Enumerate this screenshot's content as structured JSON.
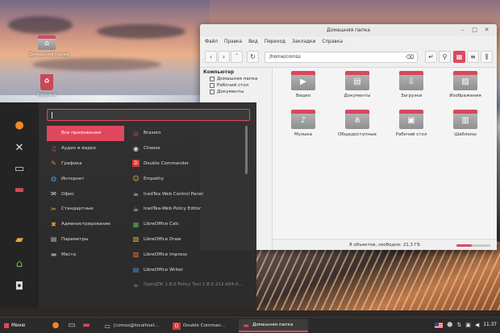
{
  "desktop": {
    "icons": [
      {
        "label": "Домашняя папка",
        "icon": "home-folder-icon"
      },
      {
        "label": "Корзина",
        "icon": "trash-icon"
      }
    ]
  },
  "file_manager": {
    "title": "Домашняя папка",
    "menu": [
      "Файл",
      "Правка",
      "Вид",
      "Переход",
      "Закладки",
      "Справка"
    ],
    "path": "/home/comss",
    "sidebar": {
      "heading": "Компьютер",
      "items": [
        "Домашняя папка",
        "Рабочий стол",
        "Документы"
      ]
    },
    "folders": [
      {
        "name": "Видео",
        "icon": "video-folder-icon",
        "glyph": "▶"
      },
      {
        "name": "Документы",
        "icon": "documents-folder-icon",
        "glyph": "▤"
      },
      {
        "name": "Загрузки",
        "icon": "downloads-folder-icon",
        "glyph": "⇩"
      },
      {
        "name": "Изображения",
        "icon": "pictures-folder-icon",
        "glyph": "▨"
      },
      {
        "name": "Музыка",
        "icon": "music-folder-icon",
        "glyph": "♪"
      },
      {
        "name": "Общедоступные",
        "icon": "public-folder-icon",
        "glyph": "⋔"
      },
      {
        "name": "Рабочий стол",
        "icon": "desktop-folder-icon",
        "glyph": "▣"
      },
      {
        "name": "Шаблоны",
        "icon": "templates-folder-icon",
        "glyph": "▥"
      }
    ],
    "status": "8 объектов, свободно: 21,3 ГБ",
    "zoom_level": 0.45
  },
  "app_menu": {
    "search_placeholder": "",
    "favorites": [
      {
        "icon": "firefox-icon",
        "glyph": "●",
        "color": "#f08a24"
      },
      {
        "icon": "settings-tools-icon",
        "glyph": "✕",
        "color": "#e0e0e0"
      },
      {
        "icon": "terminal-icon",
        "glyph": "▭",
        "color": "#cfcfcf"
      },
      {
        "icon": "file-manager-icon",
        "glyph": "▬",
        "color": "#d24a5c"
      },
      {
        "icon": "package-manager-icon",
        "glyph": "▰",
        "color": "#e8a23a"
      },
      {
        "icon": "logout-icon",
        "glyph": "⌂",
        "color": "#7ab648"
      },
      {
        "icon": "lock-icon",
        "glyph": "◘",
        "color": "#dddddd"
      }
    ],
    "categories": [
      {
        "label": "Все приложения",
        "icon": "all-apps-icon",
        "glyph": ""
      },
      {
        "label": "Аудио и видео",
        "icon": "multimedia-icon",
        "glyph": "♫"
      },
      {
        "label": "Графика",
        "icon": "graphics-icon",
        "glyph": "✎"
      },
      {
        "label": "Интернет",
        "icon": "internet-icon",
        "glyph": "◍"
      },
      {
        "label": "Офис",
        "icon": "office-icon",
        "glyph": "✉"
      },
      {
        "label": "Стандартные",
        "icon": "accessories-icon",
        "glyph": "✂"
      },
      {
        "label": "Администрирование",
        "icon": "administration-icon",
        "glyph": "✖"
      },
      {
        "label": "Параметры",
        "icon": "preferences-icon",
        "glyph": "▤"
      },
      {
        "label": "Места",
        "icon": "places-icon",
        "glyph": "▬"
      }
    ],
    "apps": [
      {
        "label": "Brasero",
        "icon": "brasero-icon",
        "glyph": "◎"
      },
      {
        "label": "Cheese",
        "icon": "cheese-icon",
        "glyph": "◉"
      },
      {
        "label": "Double Commander",
        "icon": "double-commander-icon",
        "glyph": "D"
      },
      {
        "label": "Empathy",
        "icon": "empathy-icon",
        "glyph": "☺"
      },
      {
        "label": "IcedTea Web Control Panel",
        "icon": "icedtea-control-icon",
        "glyph": "☕"
      },
      {
        "label": "IcedTea-Web Policy Editor",
        "icon": "icedtea-policy-icon",
        "glyph": "☕"
      },
      {
        "label": "LibreOffice Calc",
        "icon": "libreoffice-calc-icon",
        "glyph": "▦"
      },
      {
        "label": "LibreOffice Draw",
        "icon": "libreoffice-draw-icon",
        "glyph": "▧"
      },
      {
        "label": "LibreOffice Impress",
        "icon": "libreoffice-impress-icon",
        "glyph": "▨"
      },
      {
        "label": "LibreOffice Writer",
        "icon": "libreoffice-writer-icon",
        "glyph": "▤"
      },
      {
        "label": "OpenJDK 1.8.0 Policy Tool 1.8.0.212.b04-0...",
        "icon": "openjdk-icon",
        "glyph": "☕"
      }
    ]
  },
  "taskbar": {
    "start_label": "Меню",
    "quick": [
      {
        "icon": "firefox-icon",
        "glyph": "●",
        "color": "#f08a24"
      },
      {
        "icon": "terminal-icon",
        "glyph": "▭",
        "color": "#cfcfcf"
      },
      {
        "icon": "file-manager-icon",
        "glyph": "▬",
        "color": "#d24a5c"
      }
    ],
    "tasks": [
      {
        "label": "[comss@localhost...",
        "icon": "terminal-icon",
        "glyph": "▭"
      },
      {
        "label": "Double Comman...",
        "icon": "double-commander-icon",
        "glyph": "D"
      },
      {
        "label": "Домашняя папка",
        "icon": "file-manager-icon",
        "glyph": "▬"
      }
    ],
    "clock": "11:37"
  },
  "colors": {
    "accent": "#e0485e"
  }
}
